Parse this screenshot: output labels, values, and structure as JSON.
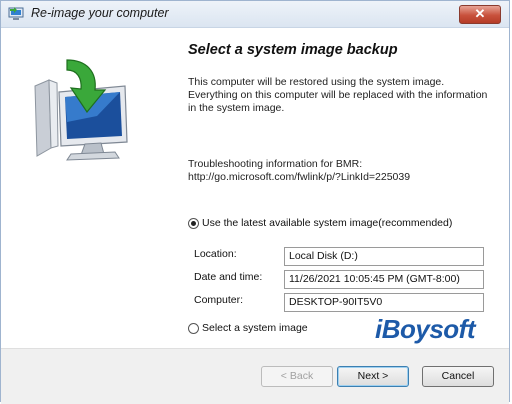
{
  "window": {
    "title": "Re-image your computer"
  },
  "main": {
    "heading": "Select a system image backup",
    "description": "This computer will be restored using the system image. Everything on this computer will be replaced with the information in the system image.",
    "bmr_line1": "Troubleshooting information for BMR:",
    "bmr_line2": "http://go.microsoft.com/fwlink/p/?LinkId=225039",
    "option_latest": {
      "label": "Use the latest available system image(recommended)",
      "checked": true
    },
    "fields": {
      "location": {
        "label": "Location:",
        "value": "Local Disk (D:)"
      },
      "date_time": {
        "label": "Date and time:",
        "value": "11/26/2021 10:05:45 PM (GMT-8:00)"
      },
      "computer": {
        "label": "Computer:",
        "value": "DESKTOP-90IT5V0"
      }
    },
    "option_select": {
      "label": "Select a system image",
      "checked": false
    },
    "watermark": "iBoysoft"
  },
  "footer": {
    "back_label": "< Back",
    "next_label": "Next >",
    "cancel_label": "Cancel"
  },
  "icons": {
    "app": "restore-computer-icon",
    "close": "close-icon",
    "illustration": "computer-restore-arrow-icon"
  },
  "colors": {
    "accent": "#1d5aa8",
    "close_button": "#c8513c",
    "arrow_green": "#3aa83a"
  }
}
